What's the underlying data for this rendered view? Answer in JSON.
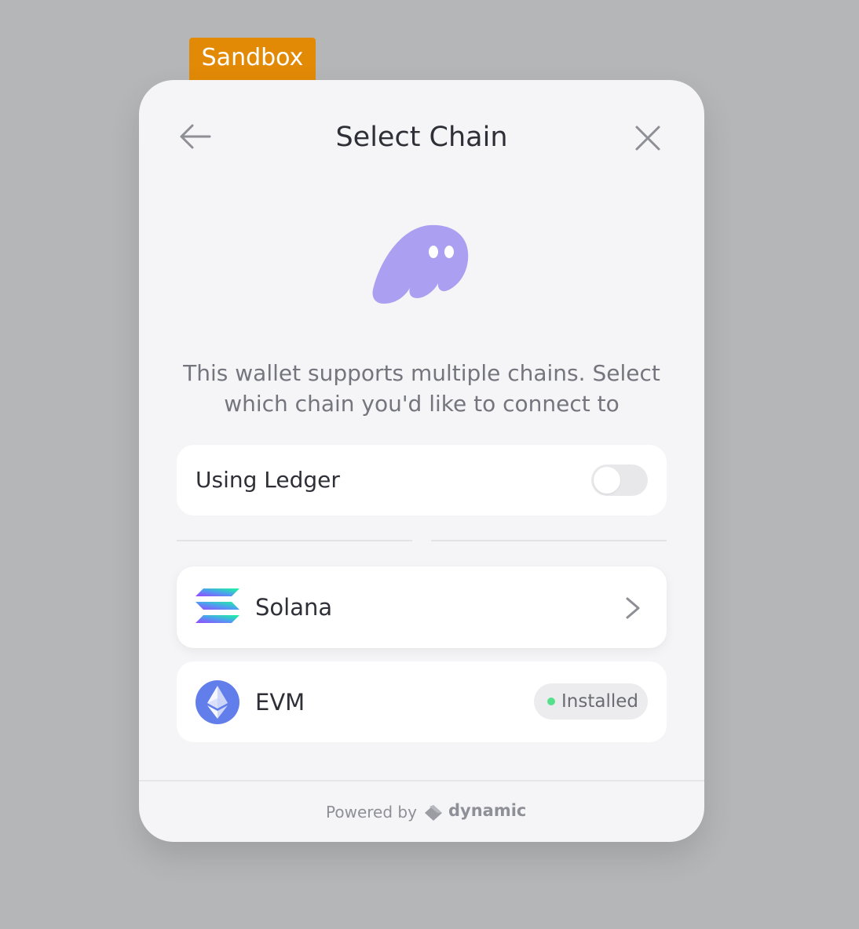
{
  "sandbox_badge": "Sandbox",
  "header": {
    "title": "Select Chain",
    "back_icon": "arrow-left-icon",
    "close_icon": "close-icon"
  },
  "wallet": {
    "logo_icon": "ghost-wallet-icon",
    "logo_color": "#ab9ff2"
  },
  "description": "This wallet supports multiple chains. Select which chain you'd like to connect to",
  "ledger": {
    "label": "Using Ledger",
    "enabled": false
  },
  "chains": [
    {
      "name": "Solana",
      "icon": "solana-icon",
      "action_icon": "chevron-right-icon"
    },
    {
      "name": "EVM",
      "icon": "ethereum-icon",
      "status": "Installed",
      "status_color": "#56e08c"
    }
  ],
  "footer": {
    "powered_by": "Powered by",
    "brand": "dynamic",
    "brand_icon": "dynamic-logo-icon"
  },
  "colors": {
    "backdrop": "#b5b6b8",
    "sandbox": "#e28a06",
    "modal": "#f5f5f7",
    "ethereum": "#627eea"
  }
}
